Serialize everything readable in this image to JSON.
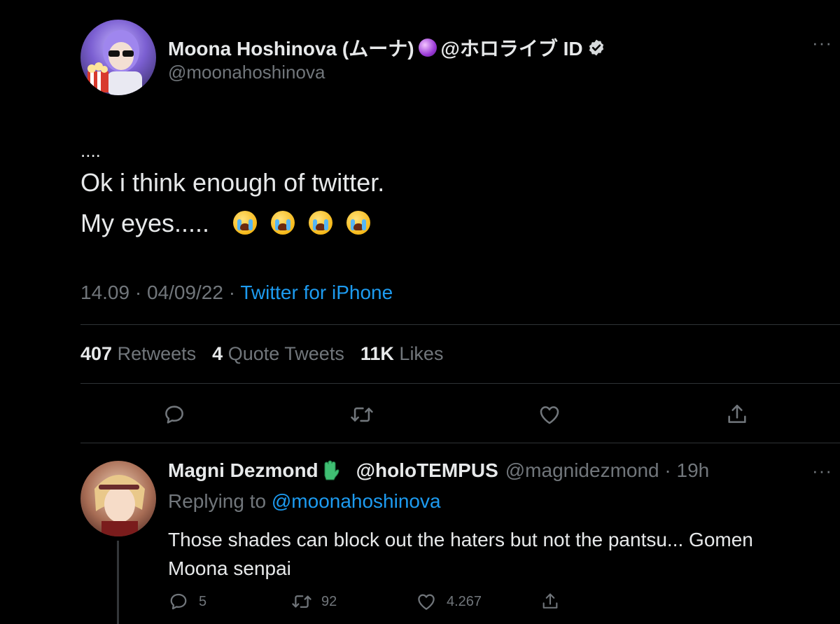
{
  "tweet": {
    "author_name": "Moona Hoshinova (ムーナ)",
    "author_suffix": "@ホロライブ ID",
    "handle": "@moonahoshinova",
    "line_dots": "....",
    "line1": "Ok i think enough of twitter.",
    "line2": "My eyes.....",
    "emoji_name": "loudly-crying-face-emoji",
    "timestamp": "14.09 · 04/09/22 ·",
    "source": "Twitter for iPhone",
    "stats": {
      "retweets_count": "407",
      "retweets_label": "Retweets",
      "quotes_count": "4",
      "quotes_label": "Quote Tweets",
      "likes_count": "11K",
      "likes_label": "Likes"
    },
    "actions": [
      "reply-icon",
      "retweet-icon",
      "like-icon",
      "share-icon"
    ]
  },
  "reply": {
    "author_name": "Magni Dezmond",
    "author_suffix": "@holoTEMPUS",
    "handle_time": "@magnidezmond · 19h",
    "replying_prefix": "Replying to",
    "replying_handle": "@moonahoshinova",
    "text": "Those shades can block out the haters but not the pantsu... Gomen Moona senpai",
    "reply_count": "5",
    "retweet_count": "92",
    "like_count": "4.267"
  },
  "colors": {
    "background": "#000000",
    "text": "#e7e9ea",
    "muted": "#71767b",
    "link": "#1d9bf0",
    "divider": "#2f3336"
  }
}
